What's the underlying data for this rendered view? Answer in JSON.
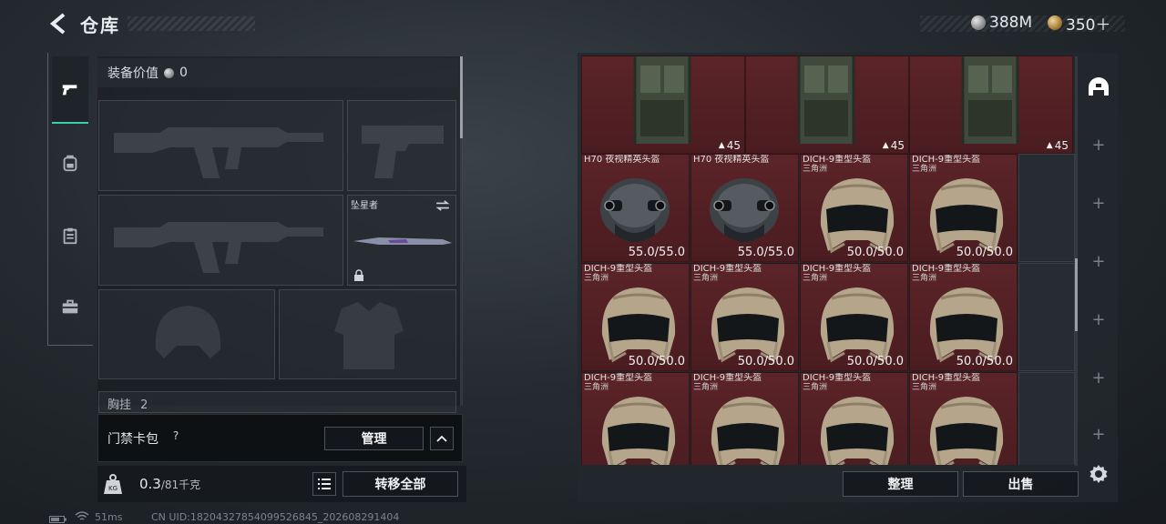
{
  "header": {
    "title": "仓库",
    "back_icon": "chevron-left-icon"
  },
  "currency": {
    "silver": {
      "icon": "silver-coin-icon",
      "value": "388M"
    },
    "gold": {
      "icon": "gold-coin-icon",
      "value": "350＋"
    }
  },
  "tabs": [
    {
      "icon": "pistol-icon",
      "active": true
    },
    {
      "icon": "backpack-icon",
      "active": false
    },
    {
      "icon": "clipboard-icon",
      "active": false
    },
    {
      "icon": "toolbox-icon",
      "active": false
    }
  ],
  "equipment": {
    "value_label": "装备价值",
    "value": "0",
    "knife_label": "坠星者",
    "chest_label": "胸挂",
    "chest_count": "2"
  },
  "access_card": {
    "label": "门禁卡包",
    "help": "?",
    "manage_label": "管理"
  },
  "weight": {
    "current": "0.3",
    "max": "/81千克"
  },
  "actions": {
    "transfer_all": "转移全部",
    "sort": "整理",
    "sell": "出售"
  },
  "status": {
    "ping": "51ms",
    "uid": "CN UID:18204327854099526845_202608291404"
  },
  "stash": {
    "row0": [
      {
        "capacity": "45"
      },
      {
        "capacity": "45"
      },
      {
        "capacity": "45"
      }
    ],
    "items": [
      {
        "name": "H70 夜视精英头盔",
        "sub": "",
        "type": "nv",
        "durability": "55.0/55.0"
      },
      {
        "name": "H70 夜视精英头盔",
        "sub": "",
        "type": "nv",
        "durability": "55.0/55.0"
      },
      {
        "name": "DICH-9重型头盔",
        "sub": "三角洲",
        "type": "dich",
        "durability": "50.0/50.0"
      },
      {
        "name": "DICH-9重型头盔",
        "sub": "三角洲",
        "type": "dich",
        "durability": "50.0/50.0"
      },
      {
        "name": "DICH-9重型头盔",
        "sub": "三角洲",
        "type": "dich",
        "durability": "50.0/50.0"
      },
      {
        "name": "DICH-9重型头盔",
        "sub": "三角洲",
        "type": "dich",
        "durability": "50.0/50.0"
      },
      {
        "name": "DICH-9重型头盔",
        "sub": "三角洲",
        "type": "dich",
        "durability": "50.0/50.0"
      },
      {
        "name": "DICH-9重型头盔",
        "sub": "三角洲",
        "type": "dich",
        "durability": "50.0/50.0"
      },
      {
        "name": "DICH-9重型头盔",
        "sub": "三角洲",
        "type": "dich",
        "durability": ""
      },
      {
        "name": "DICH-9重型头盔",
        "sub": "三角洲",
        "type": "dich",
        "durability": ""
      },
      {
        "name": "DICH-9重型头盔",
        "sub": "三角洲",
        "type": "dich",
        "durability": ""
      },
      {
        "name": "DICH-9重型头盔",
        "sub": "三角洲",
        "type": "dich",
        "durability": ""
      }
    ]
  },
  "side_icons": [
    "helmet-filter-icon",
    "plus-icon",
    "plus-icon",
    "plus-icon",
    "plus-icon",
    "plus-icon",
    "plus-icon"
  ],
  "colors": {
    "accent": "#39d1a8",
    "item_bg": "#5b2428",
    "panel_bg": "#22282d"
  }
}
